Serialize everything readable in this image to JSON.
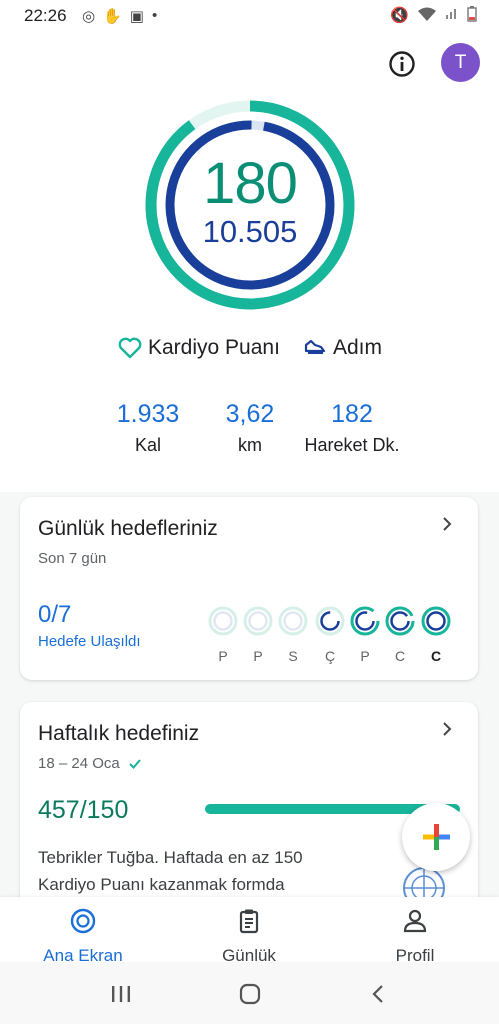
{
  "status_bar": {
    "time": "22:26"
  },
  "header": {
    "avatar_letter": "T",
    "info_icon": "info-icon"
  },
  "ring": {
    "cardio_points": "180",
    "steps": "10.505"
  },
  "legend": {
    "cardio_label": "Kardiyo Puanı",
    "steps_label": "Adım"
  },
  "stats": [
    {
      "value": "1.933",
      "unit": "Kal"
    },
    {
      "value": "3,62",
      "unit": "km"
    },
    {
      "value": "182",
      "unit": "Hareket Dk."
    }
  ],
  "daily_goals": {
    "title": "Günlük hedefleriniz",
    "subtitle": "Son 7 gün",
    "value": "0/7",
    "label": "Hedefe Ulaşıldı",
    "days": [
      "P",
      "P",
      "S",
      "Ç",
      "P",
      "C",
      "C"
    ]
  },
  "weekly_goal": {
    "title": "Haftalık hedefiniz",
    "date_range": "18 – 24 Oca",
    "value": "457/150",
    "progress_fraction": 1.0,
    "text": "Tebrikler Tuğba. Haftada en az 150 Kardiyo Puanı kazanmak formda"
  },
  "bottom_nav": {
    "home": "Ana Ekran",
    "journal": "Günlük",
    "profile": "Profil"
  },
  "colors": {
    "teal": "#17b59a",
    "navy": "#1a3f9a",
    "blue": "#1a6ed8",
    "avatar": "#7b52c9"
  }
}
